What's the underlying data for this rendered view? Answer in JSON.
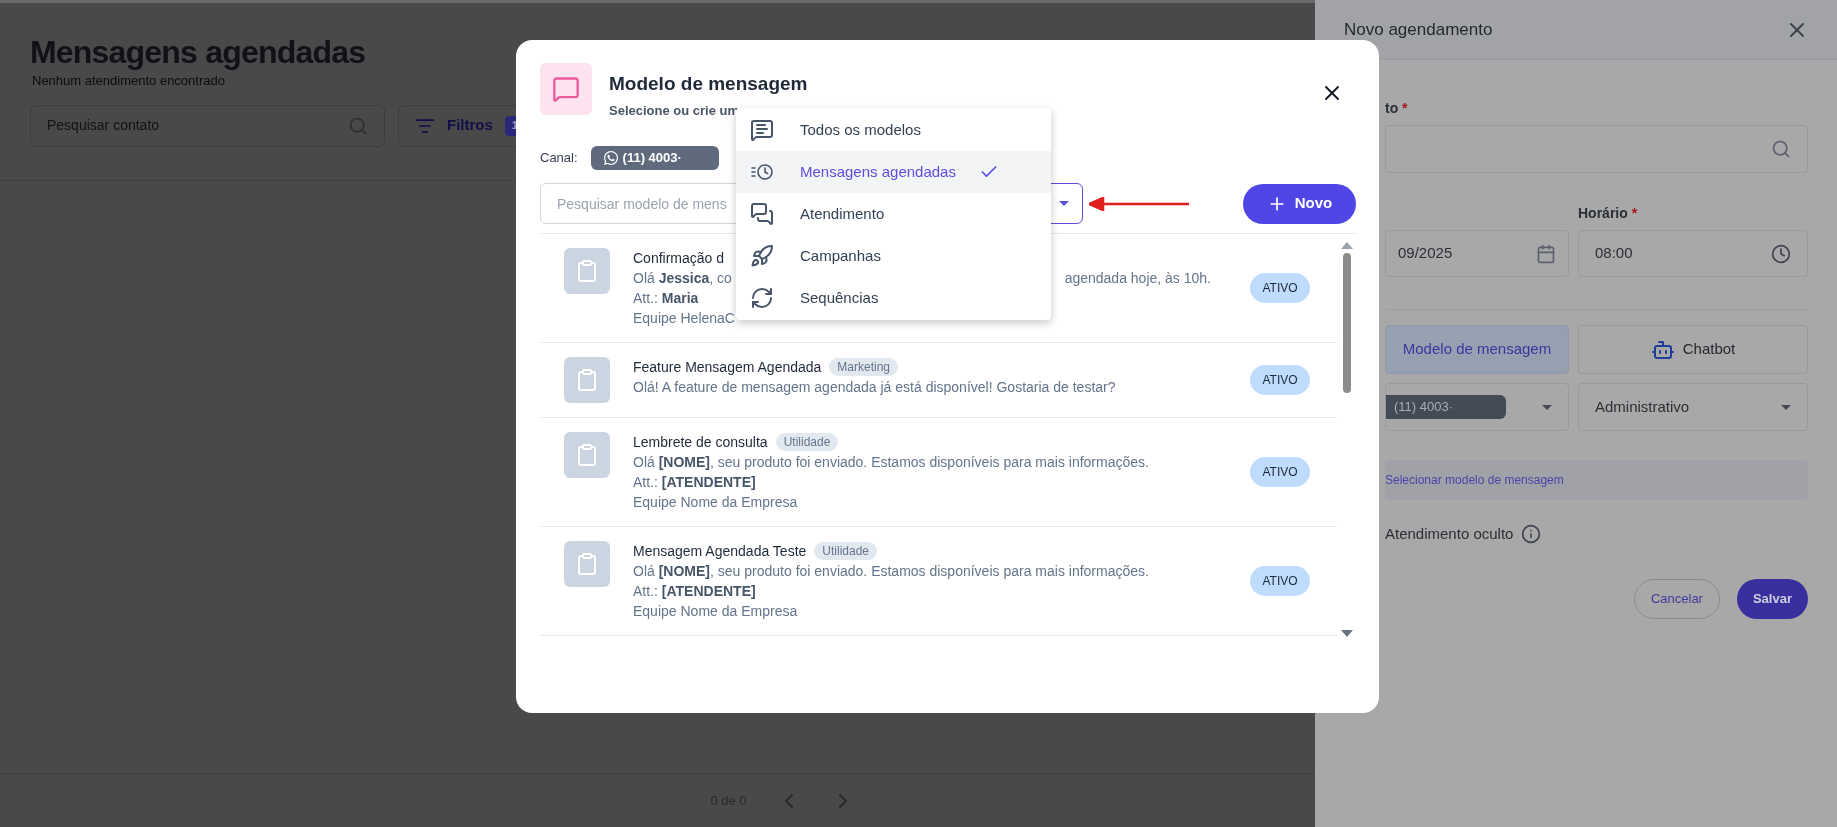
{
  "page": {
    "title": "Mensagens agendadas",
    "subtitle": "Nenhum atendimento encontrado",
    "search": {
      "placeholder": "Pesquisar contato"
    },
    "filter_button": {
      "label": "Filtros",
      "count": "1"
    },
    "pagination": {
      "label": "0 de 0"
    }
  },
  "panel": {
    "title": "Novo agendamento",
    "contact_label": {
      "text": "to",
      "mark": "*"
    },
    "date_value": "09/2025",
    "time_label": {
      "text": "Horário",
      "mark": "*"
    },
    "time_value": "08:00",
    "modes": [
      {
        "label": "Modelo de mensagem",
        "kind": "template",
        "selected": true
      },
      {
        "label": "Chatbot",
        "kind": "chatbot",
        "selected": false
      }
    ],
    "channel": "(11) 4003·",
    "department": "Administrativo",
    "template_link": "Selecionar modelo de mensagem",
    "hidden_label": "Atendimento oculto",
    "buttons": [
      {
        "label": "Cancelar",
        "kind": "secondary"
      },
      {
        "label": "Salvar",
        "kind": "primary"
      }
    ]
  },
  "modal": {
    "title": "Modelo de mensagem",
    "subtitle": "Selecione ou crie um",
    "channel_label": "Canal:",
    "channel": "(11) 4003·",
    "search": {
      "placeholder": "Pesquisar modelo de mens"
    },
    "new_button": "Novo",
    "templates": [
      {
        "title": "Confirmação d",
        "lines": [
          [
            "Olá **Jessica**, co",
            "agendada hoje, às 10h."
          ],
          [
            "Att.: **Maria**"
          ],
          [
            "Equipe HelenaC"
          ]
        ],
        "status": "ATIVO"
      },
      {
        "title": "Feature Mensagem Agendada",
        "tag": "Marketing",
        "lines": [
          [
            "Olá! A feature de mensagem agendada já está disponível! Gostaria de testar?"
          ]
        ],
        "status": "ATIVO"
      },
      {
        "title": "Lembrete de consulta",
        "tag": "Utilidade",
        "lines": [
          [
            "Olá **[NOME]**, seu produto foi enviado. Estamos disponíveis para mais informações."
          ],
          [
            "Att.: **[ATENDENTE]**"
          ],
          [
            "Equipe Nome da Empresa"
          ]
        ],
        "status": "ATIVO"
      },
      {
        "title": "Mensagem Agendada Teste",
        "tag": "Utilidade",
        "lines": [
          [
            "Olá **[NOME]**, seu produto foi enviado. Estamos disponíveis para mais informações."
          ],
          [
            "Att.: **[ATENDENTE]**"
          ],
          [
            "Equipe Nome da Empresa"
          ]
        ],
        "status": "ATIVO"
      }
    ],
    "menu": [
      {
        "label": "Todos os modelos",
        "kind": "all",
        "selected": false
      },
      {
        "label": "Mensagens agendadas",
        "kind": "scheduled",
        "selected": true
      },
      {
        "label": "Atendimento",
        "kind": "chat",
        "selected": false
      },
      {
        "label": "Campanhas",
        "kind": "campaign",
        "selected": false
      },
      {
        "label": "Sequências",
        "kind": "sequence",
        "selected": false
      }
    ]
  }
}
